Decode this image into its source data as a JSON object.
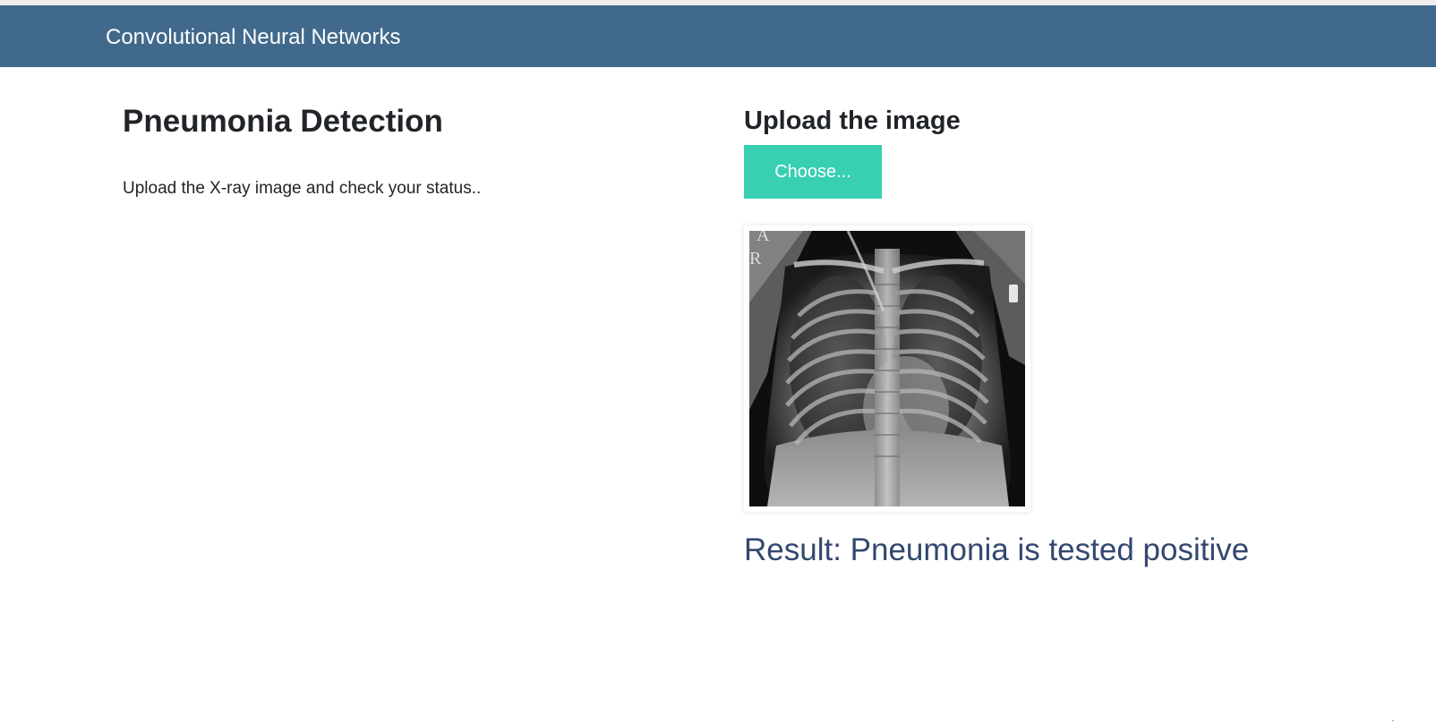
{
  "navbar": {
    "brand": "Convolutional Neural Networks",
    "background": "#41698c"
  },
  "intro": {
    "title": "Pneumonia Detection",
    "description": "Upload the X-ray image and check your status.."
  },
  "upload": {
    "heading": "Upload the image",
    "button_label": "Choose...",
    "button_color": "#38d0b1"
  },
  "preview": {
    "image_name": "chest-xray-image",
    "overlay_letters": [
      "A",
      "R"
    ]
  },
  "result": {
    "text": "Result: Pneumonia is tested positive",
    "color": "#33486e"
  }
}
